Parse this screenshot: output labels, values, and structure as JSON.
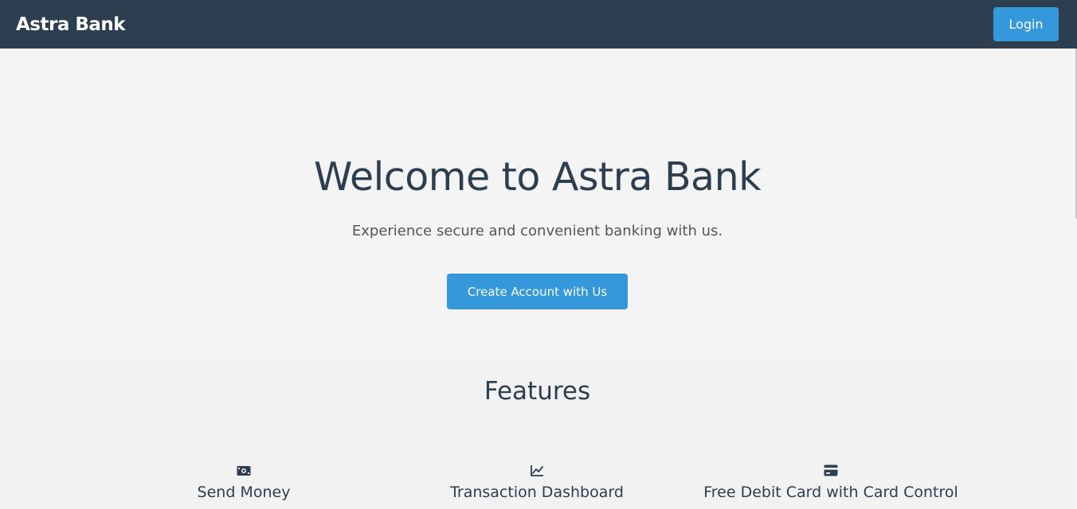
{
  "navbar": {
    "brand": "Astra Bank",
    "login_label": "Login"
  },
  "hero": {
    "title": "Welcome to Astra Bank",
    "subtitle": "Experience secure and convenient banking with us.",
    "cta_label": "Create Account with Us"
  },
  "features": {
    "title": "Features",
    "items": [
      {
        "icon": "money-bill-icon",
        "label": "Send Money"
      },
      {
        "icon": "chart-line-icon",
        "label": "Transaction Dashboard"
      },
      {
        "icon": "credit-card-icon",
        "label": "Free Debit Card with Card Control"
      }
    ]
  },
  "colors": {
    "navbar_bg": "#2c3e50",
    "accent": "#3498db",
    "page_bg": "#f4f4f4"
  }
}
